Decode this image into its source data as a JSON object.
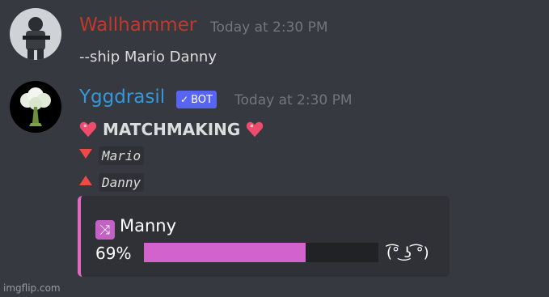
{
  "messages": [
    {
      "author": "Wallhammer",
      "author_color": "#c0392b",
      "timestamp": "Today at 2:30 PM",
      "text": "--ship Mario Danny"
    },
    {
      "author": "Yggdrasil",
      "author_color": "#3498db",
      "badge": "BOT",
      "timestamp": "Today at 2:30 PM",
      "title": "MATCHMAKING",
      "line1": "Mario",
      "line2": "Danny",
      "embed": {
        "title": "Manny",
        "percent_text": "69%",
        "percent_value": 69,
        "face": "(͡° ͜ʖ ͡°)",
        "accent": "#e468c4"
      }
    }
  ],
  "watermark": "imgflip.com"
}
